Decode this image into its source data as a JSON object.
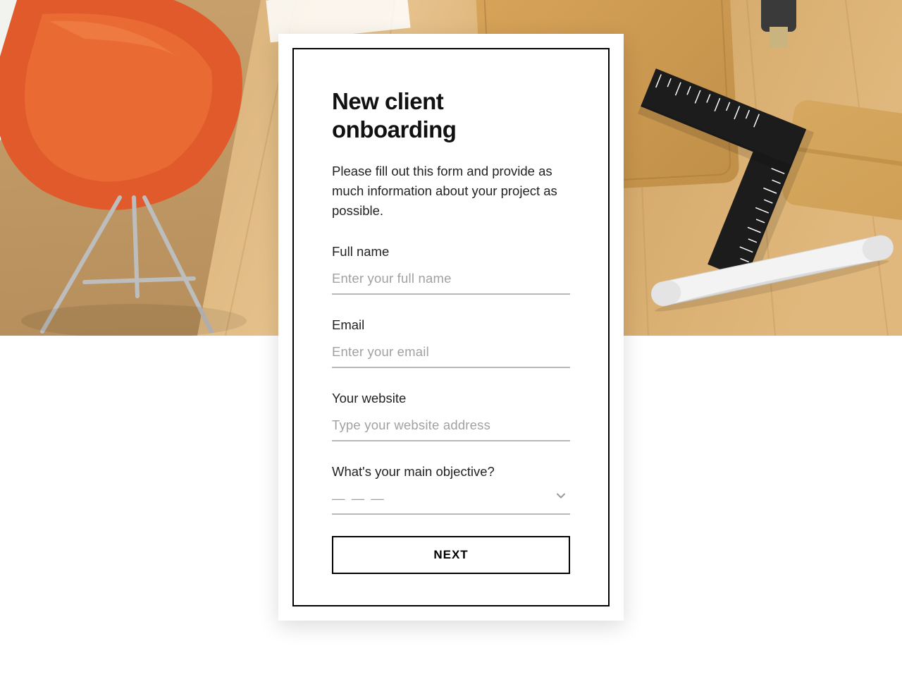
{
  "form": {
    "title": "New client onboarding",
    "description": "Please fill out this form and provide as much information about your project as possible.",
    "fields": {
      "full_name": {
        "label": "Full name",
        "placeholder": "Enter your full name",
        "value": ""
      },
      "email": {
        "label": "Email",
        "placeholder": "Enter your email",
        "value": ""
      },
      "website": {
        "label": "Your website",
        "placeholder": "Type your website address",
        "value": ""
      },
      "objective": {
        "label": "What's your main objective?",
        "placeholder": "— — —",
        "value": ""
      }
    },
    "submit_label": "NEXT"
  }
}
